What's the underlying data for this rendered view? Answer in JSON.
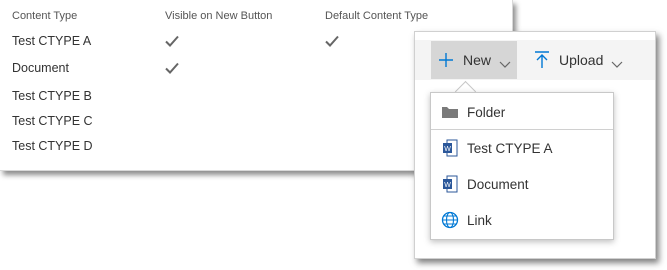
{
  "content_types": {
    "headers": {
      "content_type": "Content Type",
      "visible_on_new": "Visible on New Button",
      "default_ct": "Default Content Type"
    },
    "rows": [
      {
        "name": "Test CTYPE A",
        "visible": true,
        "default": true
      },
      {
        "name": "Document",
        "visible": true,
        "default": false
      },
      {
        "name": "Test CTYPE B",
        "visible": false,
        "default": false
      },
      {
        "name": "Test CTYPE C",
        "visible": false,
        "default": false
      },
      {
        "name": "Test CTYPE D",
        "visible": false,
        "default": false
      }
    ]
  },
  "command_bar": {
    "new_label": "New",
    "upload_label": "Upload"
  },
  "new_menu": {
    "items": [
      {
        "label": "Folder",
        "icon": "folder-icon"
      },
      {
        "label": "Test CTYPE A",
        "icon": "word-document-icon"
      },
      {
        "label": "Document",
        "icon": "word-document-icon"
      },
      {
        "label": "Link",
        "icon": "globe-link-icon"
      }
    ]
  },
  "colors": {
    "accent": "#0078d4",
    "word_blue": "#2b579a",
    "folder_gray": "#7a7a7a",
    "selected_bg": "#d6d6d6"
  }
}
